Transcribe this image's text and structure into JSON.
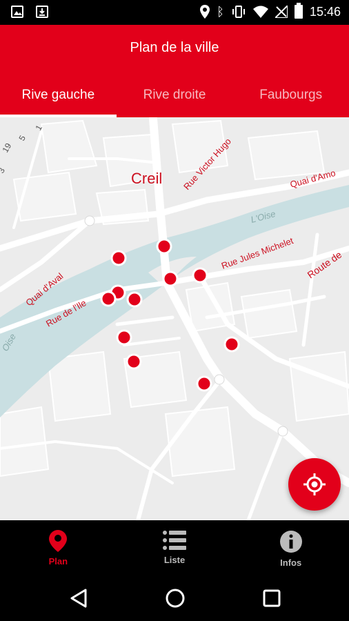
{
  "status_bar": {
    "time": "15:46"
  },
  "app_bar": {
    "title": "Plan de la ville"
  },
  "tabs": [
    {
      "label": "Rive gauche",
      "active": true
    },
    {
      "label": "Rive droite",
      "active": false
    },
    {
      "label": "Faubourgs",
      "active": false
    }
  ],
  "map": {
    "city_label": "Creil",
    "street_labels": {
      "rue_victor_hugo": "Rue Victor Hugo",
      "quai_amont": "Quai d'Amo",
      "oise_right": "L'Oise",
      "rue_jules_michelet": "Rue Jules Michelet",
      "route_de": "Route de",
      "quai_aval": "Quai d'Aval",
      "rue_ile": "Rue de l'Ile",
      "oise_left": "Oise",
      "num_19": "19",
      "num_5": "5",
      "num_1": "1",
      "num_3": "3"
    },
    "marker_count": 12
  },
  "fab": {
    "icon": "my-location-icon"
  },
  "bottom_nav": [
    {
      "label": "Plan",
      "icon": "map-pin-icon",
      "active": true
    },
    {
      "label": "Liste",
      "icon": "list-icon",
      "active": false
    },
    {
      "label": "Infos",
      "icon": "info-icon",
      "active": false
    }
  ],
  "colors": {
    "brand": "#e2001a",
    "river": "#c9dfe2",
    "map_bg": "#ececec"
  }
}
